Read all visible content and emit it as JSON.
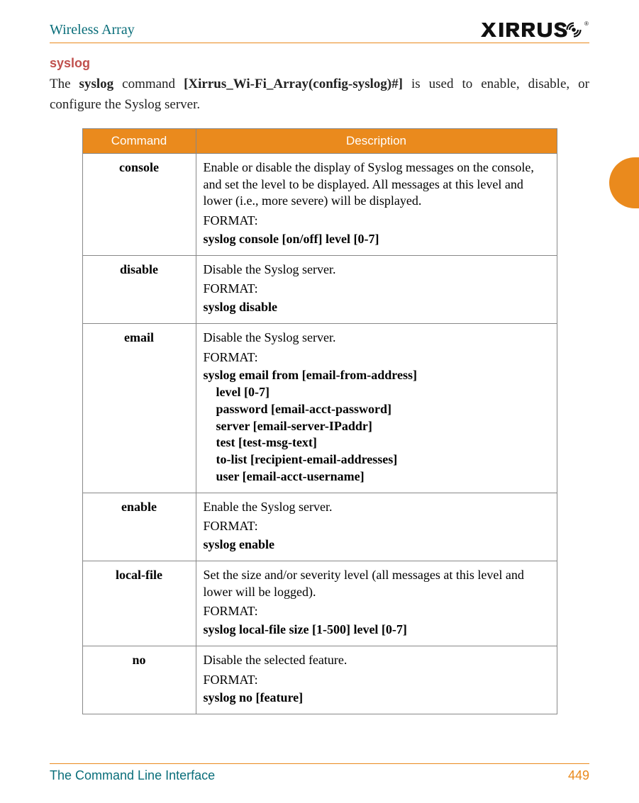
{
  "header": {
    "title": "Wireless Array",
    "logo_text": "XIRRUS"
  },
  "section": {
    "heading": "syslog",
    "intro_pre": "The ",
    "intro_cmd": "syslog",
    "intro_mid": " command ",
    "intro_prompt": "[Xirrus_Wi-Fi_Array(config-syslog)#]",
    "intro_post": " is used to enable, disable, or configure the Syslog server."
  },
  "table": {
    "headers": {
      "command": "Command",
      "description": "Description"
    },
    "rows": [
      {
        "command": "console",
        "description": "Enable or disable the display of Syslog messages on the console, and set the level to be displayed. All messages at this level and lower (i.e., more severe) will be displayed.",
        "format_label": "FORMAT:",
        "format_cmd": "syslog console [on/off] level [0-7]",
        "sub": []
      },
      {
        "command": "disable",
        "description": "Disable the Syslog server.",
        "format_label": "FORMAT:",
        "format_cmd": "syslog disable",
        "sub": []
      },
      {
        "command": "email",
        "description": "Disable the Syslog server.",
        "format_label": "FORMAT:",
        "format_cmd": "syslog email from [email-from-address]",
        "sub": [
          "level [0-7]",
          "password [email-acct-password]",
          "server [email-server-IPaddr]",
          "test [test-msg-text]",
          "to-list [recipient-email-addresses]",
          "user [email-acct-username]"
        ]
      },
      {
        "command": "enable",
        "description": "Enable the Syslog server.",
        "format_label": "FORMAT:",
        "format_cmd": "syslog enable",
        "sub": []
      },
      {
        "command": "local-file",
        "description": "Set the size and/or severity level (all messages at this level and lower will be logged).",
        "format_label": "FORMAT:",
        "format_cmd": "syslog local-file size [1-500] level [0-7]",
        "sub": []
      },
      {
        "command": "no",
        "description": "Disable the selected feature.",
        "format_label": "FORMAT:",
        "format_cmd": "syslog no [feature]",
        "sub": []
      }
    ]
  },
  "footer": {
    "title": "The Command Line Interface",
    "page": "449"
  }
}
